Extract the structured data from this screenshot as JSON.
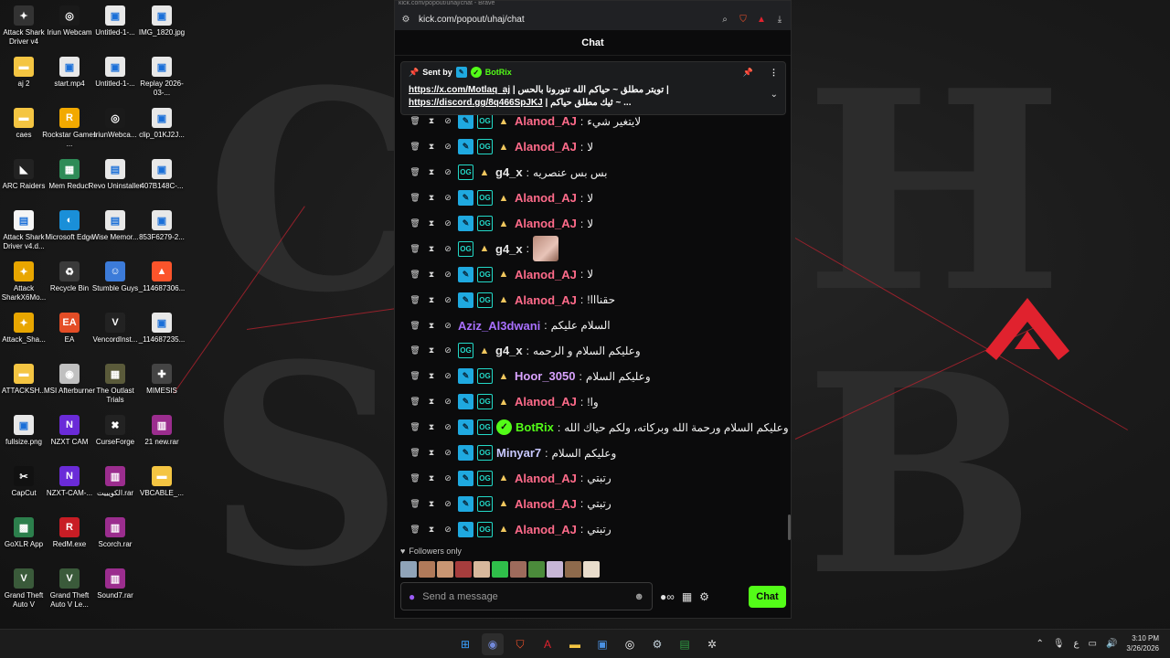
{
  "desktop": {
    "icons": [
      {
        "label": "Attack Shark Driver v4",
        "glyph": "✦",
        "color": "#333"
      },
      {
        "label": "Iriun Webcam",
        "glyph": "◎",
        "color": "#1a1a1a"
      },
      {
        "label": "Untitled-1-...",
        "glyph": "▣",
        "color": "#e8e8e8"
      },
      {
        "label": "IMG_1820.jpg",
        "glyph": "▣",
        "color": "#e8e8e8"
      },
      {
        "label": "aj 2",
        "glyph": "▬",
        "color": "#f4c542"
      },
      {
        "label": "start.mp4",
        "glyph": "▣",
        "color": "#e8e8e8"
      },
      {
        "label": "Untitled-1-...",
        "glyph": "▣",
        "color": "#e8e8e8"
      },
      {
        "label": "Replay 2026-03-...",
        "glyph": "▣",
        "color": "#e8e8e8"
      },
      {
        "label": "caes",
        "glyph": "▬",
        "color": "#f4c542"
      },
      {
        "label": "Rockstar Games ...",
        "glyph": "R",
        "color": "#f2a900"
      },
      {
        "label": "IriunWebca...",
        "glyph": "◎",
        "color": "#1a1a1a"
      },
      {
        "label": "clip_01KJ2J...",
        "glyph": "▣",
        "color": "#e8e8e8"
      },
      {
        "label": "ARC Raiders",
        "glyph": "◣",
        "color": "#222"
      },
      {
        "label": "Mem Reduct",
        "glyph": "▦",
        "color": "#2e8b57"
      },
      {
        "label": "Revo Uninstaller",
        "glyph": "▤",
        "color": "#e8e8e8"
      },
      {
        "label": "407B148C-...",
        "glyph": "▣",
        "color": "#e8e8e8"
      },
      {
        "label": "Attack Shark Driver v4.d...",
        "glyph": "▤",
        "color": "#f5f5f5"
      },
      {
        "label": "Microsoft Edge",
        "glyph": "◐",
        "color": "#1a8fd8"
      },
      {
        "label": "Wise Memor...",
        "glyph": "▤",
        "color": "#e8e8e8"
      },
      {
        "label": "853F6279-2...",
        "glyph": "▣",
        "color": "#e8e8e8"
      },
      {
        "label": "Attack SharkX6Mo...",
        "glyph": "✦",
        "color": "#e8a600"
      },
      {
        "label": "Recycle Bin",
        "glyph": "♻",
        "color": "#3a3a3a"
      },
      {
        "label": "Stumble Guys",
        "glyph": "☺",
        "color": "#3c7bd9"
      },
      {
        "label": "_114687306...",
        "glyph": "▲",
        "color": "#fb542b"
      },
      {
        "label": "Attack_Sha...",
        "glyph": "✦",
        "color": "#e8a600"
      },
      {
        "label": "EA",
        "glyph": "EA",
        "color": "#e44d26"
      },
      {
        "label": "VencordInst...",
        "glyph": "V",
        "color": "#222"
      },
      {
        "label": "_114687235...",
        "glyph": "▣",
        "color": "#e8e8e8"
      },
      {
        "label": "ATTACKSH...",
        "glyph": "▬",
        "color": "#f4c542"
      },
      {
        "label": "MSI Afterburner",
        "glyph": "◉",
        "color": "#c0c0c0"
      },
      {
        "label": "The Outlast Trials",
        "glyph": "▦",
        "color": "#5a5a3a"
      },
      {
        "label": "MIMESIS",
        "glyph": "✚",
        "color": "#444"
      },
      {
        "label": "fullsize.png",
        "glyph": "▣",
        "color": "#e8e8e8"
      },
      {
        "label": "NZXT CAM",
        "glyph": "N",
        "color": "#6a2bd8"
      },
      {
        "label": "CurseForge",
        "glyph": "✖",
        "color": "#222"
      },
      {
        "label": "21 new.rar",
        "glyph": "▥",
        "color": "#9b2d8e"
      },
      {
        "label": "CapCut",
        "glyph": "✂",
        "color": "#111"
      },
      {
        "label": "NZXT-CAM-...",
        "glyph": "N",
        "color": "#6a2bd8"
      },
      {
        "label": "الكويييت.rar",
        "glyph": "▥",
        "color": "#9b2d8e"
      },
      {
        "label": "VBCABLE_...",
        "glyph": "▬",
        "color": "#f4c542"
      },
      {
        "label": "GoXLR App",
        "glyph": "▩",
        "color": "#2c7f4c"
      },
      {
        "label": "RedM.exe",
        "glyph": "R",
        "color": "#c81d25"
      },
      {
        "label": "Scorch.rar",
        "glyph": "▥",
        "color": "#9b2d8e"
      },
      {
        "label": "",
        "glyph": "",
        "color": "transparent"
      },
      {
        "label": "Grand Theft Auto V",
        "glyph": "V",
        "color": "#3a5a3a"
      },
      {
        "label": "Grand Theft Auto V Le...",
        "glyph": "V",
        "color": "#3a5a3a"
      },
      {
        "label": "Sound7.rar",
        "glyph": "▥",
        "color": "#9b2d8e"
      }
    ]
  },
  "browser": {
    "url": "kick.com/popout/uhaj/chat",
    "title": "kick.com/popout/uhaj/chat - Brave"
  },
  "chat": {
    "header": "Chat",
    "pinned": {
      "sent_by": "Sent by",
      "bot_name": "BotRix",
      "line1_link": "https://x.com/Motlaq_aj",
      "line1_text": " | تويتر مطلق ~ حياكم الله تنورونا بالحس |",
      "line2_link": "https://discord.gg/8q466SpJKJ",
      "line2_text": " | ثيك مطلق حياكم ~ ..."
    },
    "messages": [
      {
        "badges": [
          "blue",
          "og",
          "crown"
        ],
        "user": "Alanod_AJ",
        "color": "#ff6b8a",
        "text": "لايتغير شيء"
      },
      {
        "badges": [
          "blue",
          "og",
          "crown"
        ],
        "user": "Alanod_AJ",
        "color": "#ff6b8a",
        "text": "لا"
      },
      {
        "badges": [
          "og",
          "crown"
        ],
        "user": "g4_x",
        "color": "#e6e6e6",
        "text": "بس بس عنصريه"
      },
      {
        "badges": [
          "blue",
          "og",
          "crown"
        ],
        "user": "Alanod_AJ",
        "color": "#ff6b8a",
        "text": "لا"
      },
      {
        "badges": [
          "blue",
          "og",
          "crown"
        ],
        "user": "Alanod_AJ",
        "color": "#ff6b8a",
        "text": "لا"
      },
      {
        "badges": [
          "og",
          "crown"
        ],
        "user": "g4_x",
        "color": "#e6e6e6",
        "text": "",
        "emote": true
      },
      {
        "badges": [
          "blue",
          "og",
          "crown"
        ],
        "user": "Alanod_AJ",
        "color": "#ff6b8a",
        "text": "لا"
      },
      {
        "badges": [
          "blue",
          "og",
          "crown"
        ],
        "user": "Alanod_AJ",
        "color": "#ff6b8a",
        "text": "حقنااا!"
      },
      {
        "badges": [],
        "user": "Aziz_Al3dwani",
        "color": "#a970ff",
        "text": "السلام عليكم"
      },
      {
        "badges": [
          "og",
          "crown"
        ],
        "user": "g4_x",
        "color": "#e6e6e6",
        "text": "وعليكم السلام و الرحمه"
      },
      {
        "badges": [
          "blue",
          "og",
          "crown"
        ],
        "user": "Hoor_3050",
        "color": "#d9a3ff",
        "text": "وعليكم السلام"
      },
      {
        "badges": [
          "blue",
          "og",
          "crown"
        ],
        "user": "Alanod_AJ",
        "color": "#ff6b8a",
        "text": "وا!"
      },
      {
        "badges": [
          "blue",
          "og",
          "green"
        ],
        "user": "BotRix",
        "color": "#53fc18",
        "text": "وعليكم السلام ورحمة الله وبركاته، ولكم حياك الله"
      },
      {
        "badges": [
          "blue",
          "og"
        ],
        "user": "Minyar7",
        "color": "#c8c8ff",
        "text": "وعليكم السلام"
      },
      {
        "badges": [
          "blue",
          "og",
          "crown"
        ],
        "user": "Alanod_AJ",
        "color": "#ff6b8a",
        "text": "رتبتي"
      },
      {
        "badges": [
          "blue",
          "og",
          "crown"
        ],
        "user": "Alanod_AJ",
        "color": "#ff6b8a",
        "text": "رتبتي"
      },
      {
        "badges": [
          "blue",
          "og",
          "crown"
        ],
        "user": "Alanod_AJ",
        "color": "#ff6b8a",
        "text": "رتبتي"
      }
    ],
    "followers_only": "Followers only",
    "input_placeholder": "Send a message",
    "chat_button": "Chat"
  },
  "taskbar": {
    "time": "3:10 PM",
    "date": "3/26/2026",
    "lang": "ع"
  },
  "colors": {
    "kick_green": "#53fc18",
    "apex_red": "#e0222e"
  }
}
